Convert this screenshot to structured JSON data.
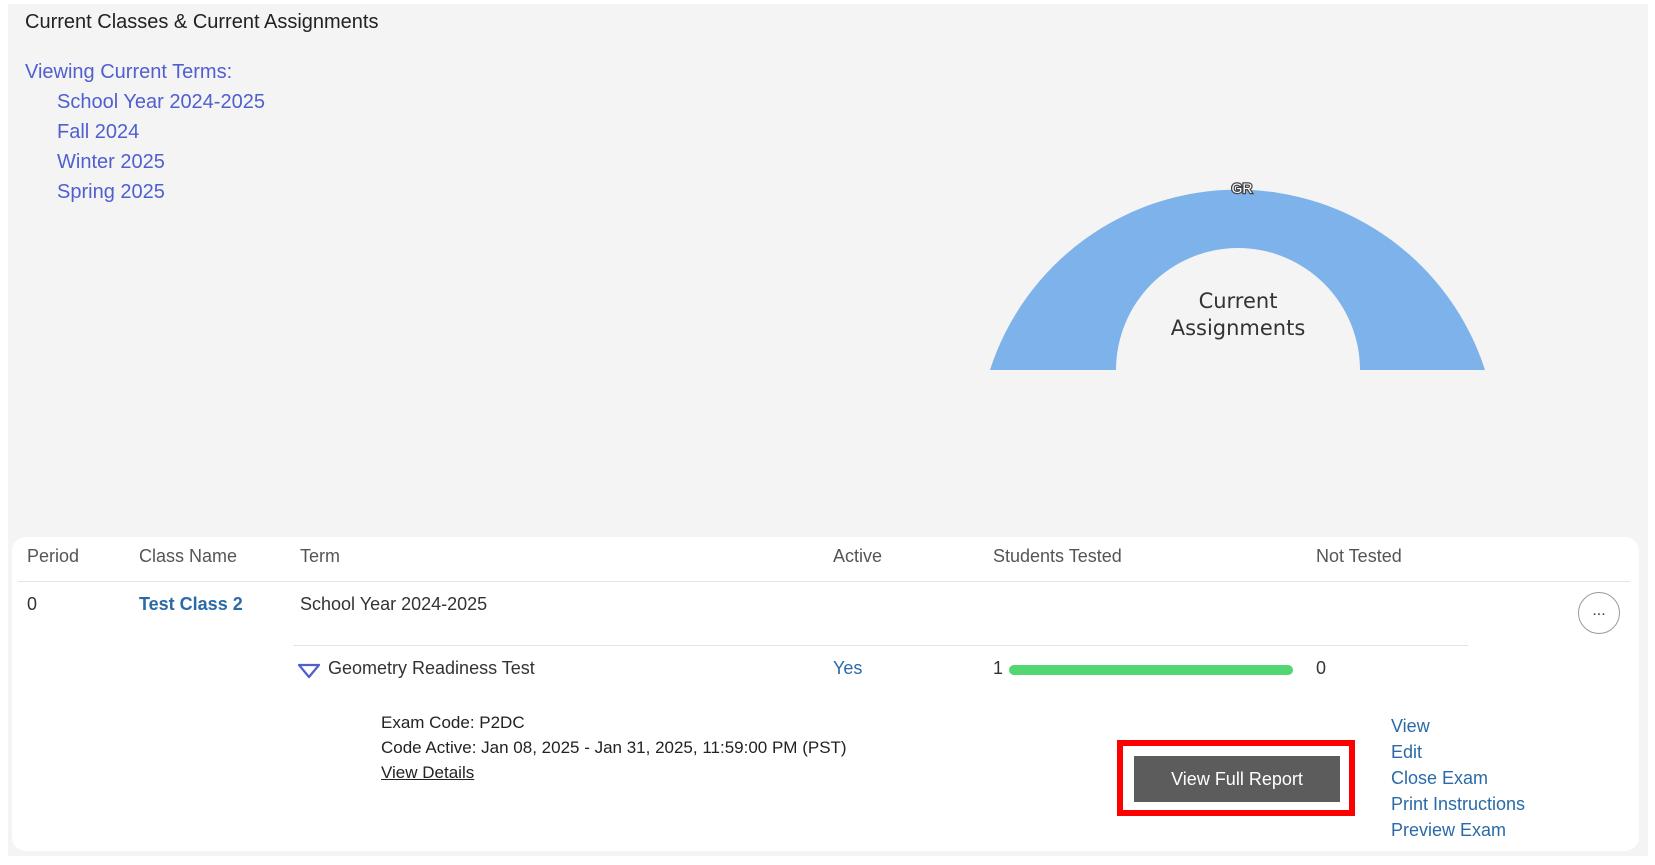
{
  "section_title": "Current Classes & Current Assignments",
  "terms": {
    "heading": "Viewing Current Terms:",
    "items": [
      "School Year 2024-2025",
      "Fall 2024",
      "Winter 2025",
      "Spring 2025"
    ]
  },
  "chart_data": {
    "type": "pie",
    "title": "",
    "center_label": "Current Assignments",
    "slices": [
      {
        "label": "GR",
        "value": 1,
        "color": "#7db3ea"
      }
    ]
  },
  "table": {
    "headers": [
      "Period",
      "Class Name",
      "Term",
      "Active",
      "Students Tested",
      "Not Tested"
    ],
    "row": {
      "period": "0",
      "class_name": "Test Class 2",
      "term": "School Year 2024-2025",
      "more_label": "..."
    },
    "assignment": {
      "name": "Geometry Readiness Test",
      "active": "Yes",
      "students_tested": "1",
      "not_tested": "0",
      "tested_fraction": 1.0,
      "progress_color": "#52d671",
      "exam_code": "Exam Code: P2DC",
      "code_active": "Code Active: Jan 08, 2025 - Jan 31, 2025, 11:59:00 PM (PST)",
      "view_details": "View Details",
      "report_button": "View Full Report",
      "actions": [
        "View",
        "Edit",
        "Close Exam",
        "Print Instructions",
        "Preview Exam"
      ]
    }
  },
  "colors": {
    "link": "#4f5fcf",
    "accent_blue": "#2a6aa8",
    "highlight": "#ff0000",
    "button_bg": "#5c5c5c"
  }
}
